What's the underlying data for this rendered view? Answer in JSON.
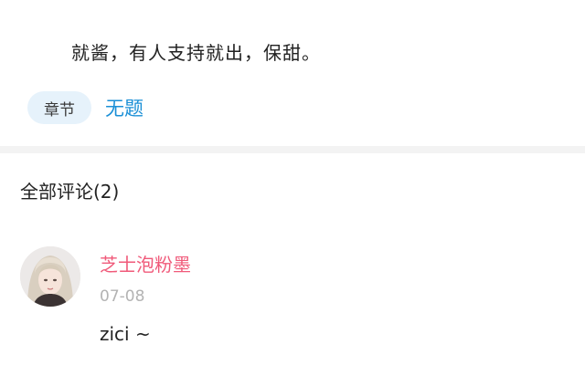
{
  "post": {
    "text": "就酱，有人支持就出，保甜。"
  },
  "chapter": {
    "tag_label": "章节",
    "link_label": "无题"
  },
  "comments": {
    "header": "全部评论(2)",
    "items": [
      {
        "username": "芝士泡粉墨",
        "date": "07-08",
        "text": "zici ~"
      }
    ]
  },
  "colors": {
    "accent_blue": "#1a8fd6",
    "tag_background": "#e6f2fb",
    "username_pink": "#f05a7a",
    "muted_gray": "#b3b3b3",
    "divider_gray": "#f3f3f3"
  }
}
